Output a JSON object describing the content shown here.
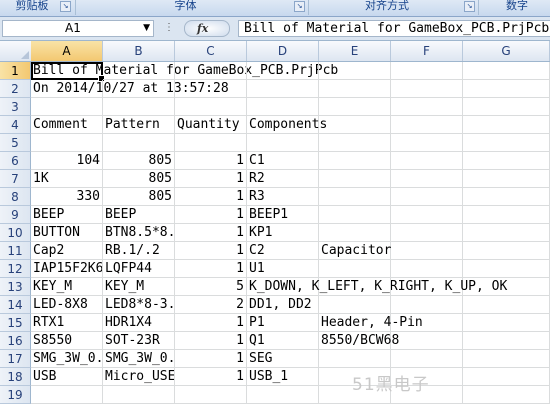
{
  "ribbon": {
    "groups": [
      {
        "label": "剪贴板"
      },
      {
        "label": "字体"
      },
      {
        "label": "对齐方式"
      },
      {
        "label": "数字"
      }
    ]
  },
  "formula_bar": {
    "name_box": "A1",
    "fx_label": "fx",
    "formula": "Bill of Material for GameBox_PCB.PrjPcb"
  },
  "columns": [
    "A",
    "B",
    "C",
    "D",
    "E",
    "F",
    "G"
  ],
  "selected_column": "A",
  "selected_row": 1,
  "rows": [
    {
      "n": "1",
      "A": "Bill of Material for GameBox_PCB.PrjPcb",
      "B": "",
      "C": "",
      "D": "",
      "E": ""
    },
    {
      "n": "2",
      "A": "On 2014/10/27 at 13:57:28",
      "B": "",
      "C": "",
      "D": "",
      "E": ""
    },
    {
      "n": "3",
      "A": "",
      "B": "",
      "C": "",
      "D": "",
      "E": ""
    },
    {
      "n": "4",
      "A": "Comment",
      "B": "Pattern",
      "C": "Quantity",
      "D": "Components",
      "E": ""
    },
    {
      "n": "5",
      "A": "",
      "B": "",
      "C": "",
      "D": "",
      "E": ""
    },
    {
      "n": "6",
      "A": "104",
      "B": "805",
      "C": "1",
      "D": "C1",
      "E": ""
    },
    {
      "n": "7",
      "A": "1K",
      "B": "805",
      "C": "1",
      "D": "R2",
      "E": ""
    },
    {
      "n": "8",
      "A": "330",
      "B": "805",
      "C": "1",
      "D": "R3",
      "E": ""
    },
    {
      "n": "9",
      "A": "BEEP",
      "B": "BEEP",
      "C": "1",
      "D": "BEEP1",
      "E": ""
    },
    {
      "n": "10",
      "A": "BUTTON",
      "B": "BTN8.5*8.",
      "C": "1",
      "D": "KP1",
      "E": ""
    },
    {
      "n": "11",
      "A": "Cap2",
      "B": "RB.1/.2",
      "C": "1",
      "D": "C2",
      "E": "Capacitor"
    },
    {
      "n": "12",
      "A": "IAP15F2K6",
      "B": "LQFP44",
      "C": "1",
      "D": "U1",
      "E": ""
    },
    {
      "n": "13",
      "A": "KEY_M",
      "B": "KEY_M",
      "C": "5",
      "D": "K_DOWN, K_LEFT, K_RIGHT, K_UP, OK",
      "E": ""
    },
    {
      "n": "14",
      "A": "LED-8X8",
      "B": "LED8*8-3.",
      "C": "2",
      "D": "DD1, DD2",
      "E": ""
    },
    {
      "n": "15",
      "A": "RTX1",
      "B": "HDR1X4",
      "C": "1",
      "D": "P1",
      "E": "Header, 4-Pin"
    },
    {
      "n": "16",
      "A": "S8550",
      "B": "SOT-23R",
      "C": "1",
      "D": "Q1",
      "E": "8550/BCW68"
    },
    {
      "n": "17",
      "A": "SMG_3W_0.",
      "B": "SMG_3W_0.",
      "C": "1",
      "D": "SEG",
      "E": ""
    },
    {
      "n": "18",
      "A": "USB",
      "B": "Micro_USE",
      "C": "1",
      "D": "USB_1",
      "E": ""
    },
    {
      "n": "19",
      "A": "",
      "B": "",
      "C": "",
      "D": "",
      "E": ""
    }
  ],
  "numeric_columns": [
    "A_numeric_rows",
    "B",
    "C"
  ],
  "watermark": "51黑电子"
}
